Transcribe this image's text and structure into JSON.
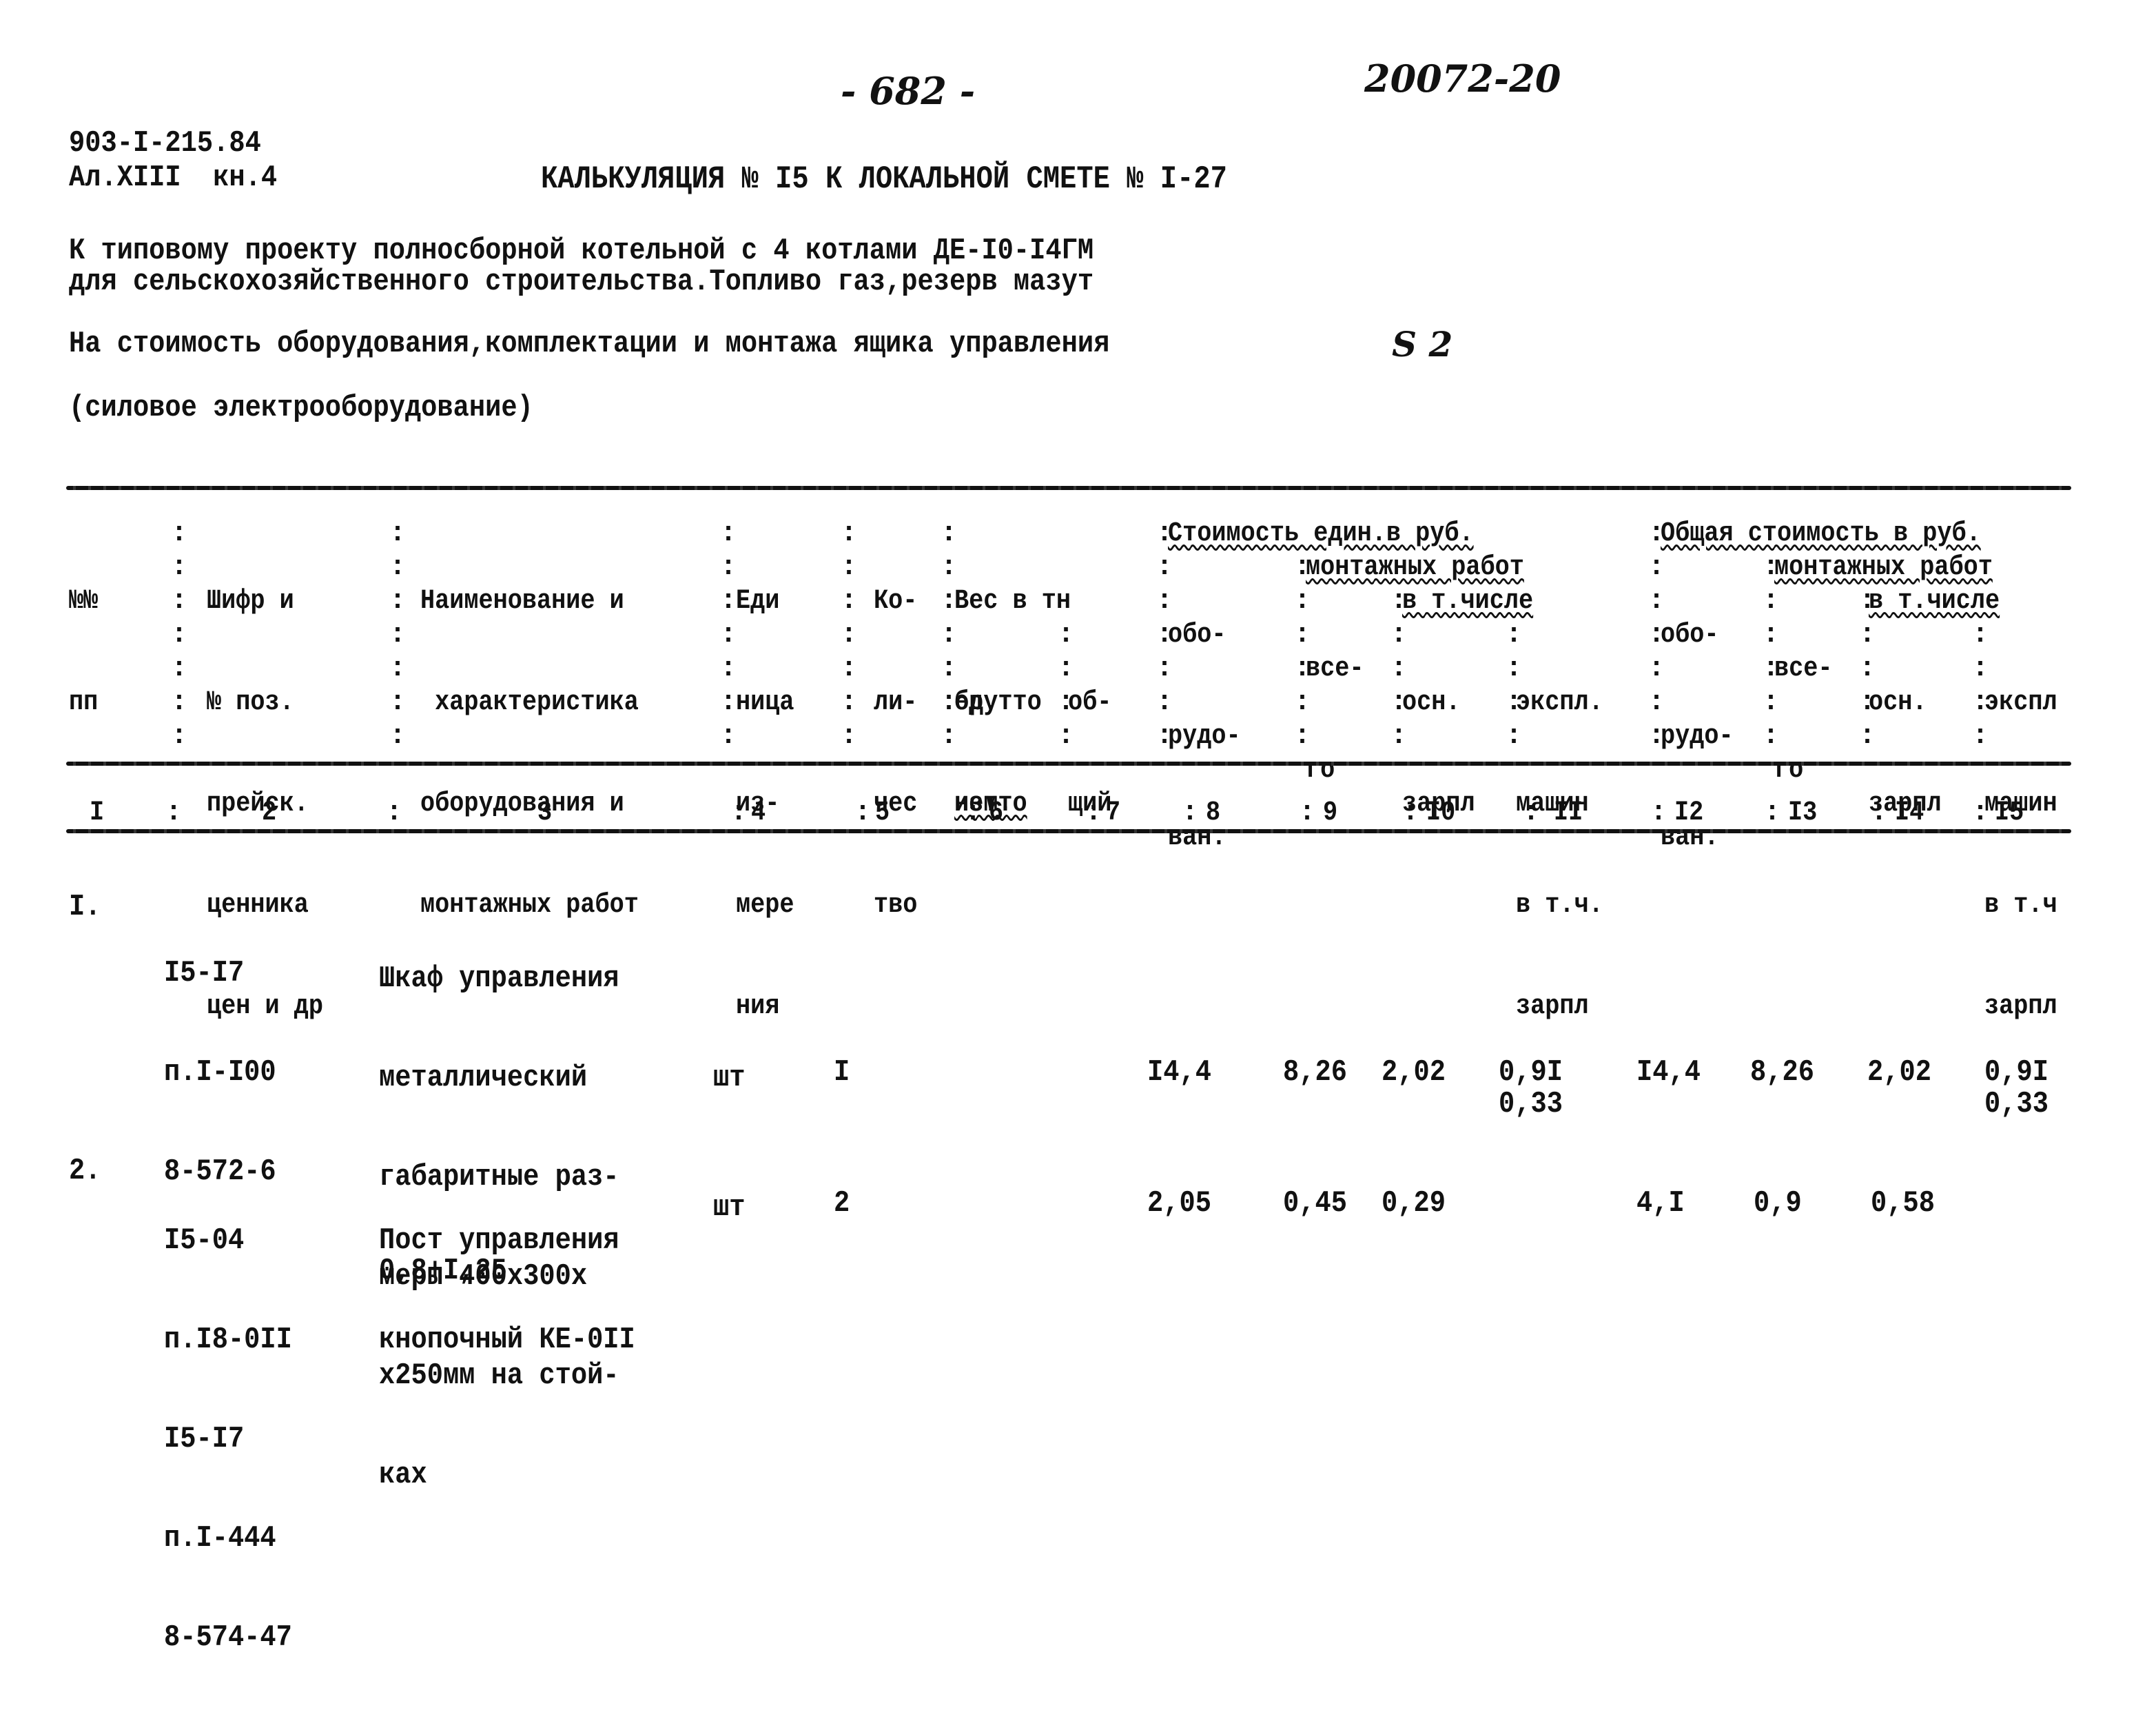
{
  "page_number": "- 682 -",
  "stamp_code": "20072-20",
  "doc_ref": {
    "line1": "903-I-215.84",
    "line2": "Ал.XIII  кн.4"
  },
  "title": "КАЛЬКУЛЯЦИЯ № I5 К ЛОКАЛЬНОЙ СМЕТЕ № I-27",
  "subtitle": {
    "line1": "К типовому проекту полносборной котельной с 4 котлами ДЕ-I0-I4ГМ",
    "line2": "для сельскохозяйственного строительства.Топливо газ,резерв мазут",
    "line3_text": "На стоимость оборудования,комплектации и монтажа ящика управления",
    "line3_mark": "S 2",
    "line4": "(силовое электрооборудование)"
  },
  "table": {
    "header": {
      "c1": [
        "№№",
        "пп"
      ],
      "c2": [
        "Шифр и",
        "№ поз.",
        "прейск.",
        "ценника",
        "цен и др"
      ],
      "c3": [
        "Наименование и",
        " характеристика",
        "оборудования и",
        "монтажных работ"
      ],
      "c4": [
        "Еди",
        "ница",
        "из-",
        "мере",
        "ния"
      ],
      "c5": [
        "Ко-",
        "ли-",
        "чес",
        "тво"
      ],
      "c6_group": [
        "Вес в тн",
        "брутто",
        "нетто"
      ],
      "c6": [
        "ед.",
        "изм."
      ],
      "c7": [
        "об-",
        "щий"
      ],
      "unit_cost_group": "Стоимость един.в руб.",
      "c8": [
        "обо-",
        "рудо-",
        "ван."
      ],
      "mount_group_unit": "монтажных работ",
      "c9": [
        "все-",
        "го"
      ],
      "incl_group_unit": "в т.числе",
      "c10": [
        "осн.",
        "зарпл"
      ],
      "c11": [
        "экспл.",
        "машин",
        "в т.ч.",
        "зарпл"
      ],
      "total_cost_group": "Общая стоимость в руб.",
      "c12": [
        "обо-",
        "рудо-",
        "ван."
      ],
      "mount_group_total": "монтажных работ",
      "c13": [
        "все-",
        "го"
      ],
      "incl_group_total": "в т.числе",
      "c14": [
        "осн.",
        "зарпл"
      ],
      "c15": [
        "экспл",
        "машин",
        "в т.ч",
        "зарпл"
      ]
    },
    "column_numbers": [
      "I",
      "2",
      "3",
      "4",
      "5",
      "6",
      "7",
      "8",
      "9",
      "I0",
      "II",
      "I2",
      "I3",
      "I4",
      "I5"
    ],
    "rows": [
      {
        "num": "I.",
        "code": [
          "I5-I7",
          "п.I-I00",
          "8-572-6"
        ],
        "name": [
          "Шкаф управления",
          "металлический",
          "габаритные раз-",
          "меры 400х300х",
          "х250мм на стой-",
          "ках"
        ],
        "unit": "шт",
        "qty": "I",
        "unit_equipment": "I4,4",
        "unit_mount_total": "8,26",
        "unit_base_salary": "2,02",
        "unit_machines": "0,9I",
        "unit_machines_salary": "0,33",
        "total_equipment": "I4,4",
        "total_mount_total": "8,26",
        "total_base_salary": "2,02",
        "total_machines": "0,9I",
        "total_machines_salary": "0,33"
      },
      {
        "num": "2.",
        "code": [
          "I5-04",
          "п.I8-0II",
          "I5-I7",
          "п.I-444",
          "8-574-47"
        ],
        "name": [
          "Пост управления",
          "кнопочный КЕ-0II"
        ],
        "name_note": "0,8+I,25",
        "unit": "шт",
        "qty": "2",
        "unit_equipment": "2,05",
        "unit_mount_total": "0,45",
        "unit_base_salary": "0,29",
        "total_equipment": "4,I",
        "total_mount_total": "0,9",
        "total_base_salary": "0,58"
      }
    ]
  }
}
